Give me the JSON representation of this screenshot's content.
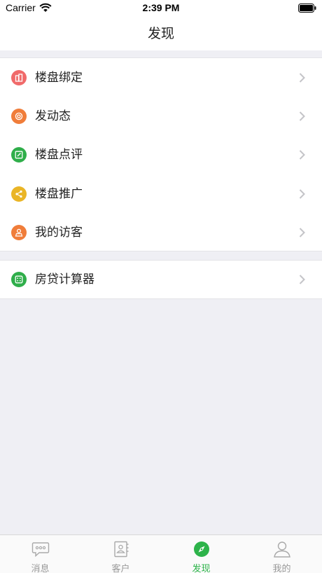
{
  "status_bar": {
    "carrier": "Carrier",
    "time": "2:39 PM"
  },
  "nav": {
    "title": "发现"
  },
  "groups": [
    {
      "items": [
        {
          "label": "楼盘绑定",
          "icon": "building-icon",
          "color": "#f06a6a"
        },
        {
          "label": "发动态",
          "icon": "camera-icon",
          "color": "#f07d3a"
        },
        {
          "label": "楼盘点评",
          "icon": "edit-icon",
          "color": "#2fae4a"
        },
        {
          "label": "楼盘推广",
          "icon": "share-icon",
          "color": "#eab526"
        },
        {
          "label": "我的访客",
          "icon": "visitor-icon",
          "color": "#f07d3a"
        }
      ]
    },
    {
      "items": [
        {
          "label": "房贷计算器",
          "icon": "calculator-icon",
          "color": "#2fae4a"
        }
      ]
    }
  ],
  "tabs": [
    {
      "label": "消息",
      "icon": "message-icon",
      "active": false
    },
    {
      "label": "客户",
      "icon": "contacts-icon",
      "active": false
    },
    {
      "label": "发现",
      "icon": "compass-icon",
      "active": true
    },
    {
      "label": "我的",
      "icon": "person-icon",
      "active": false
    }
  ],
  "colors": {
    "accent": "#2db34a",
    "inactive": "#999999",
    "background": "#efeff4"
  }
}
